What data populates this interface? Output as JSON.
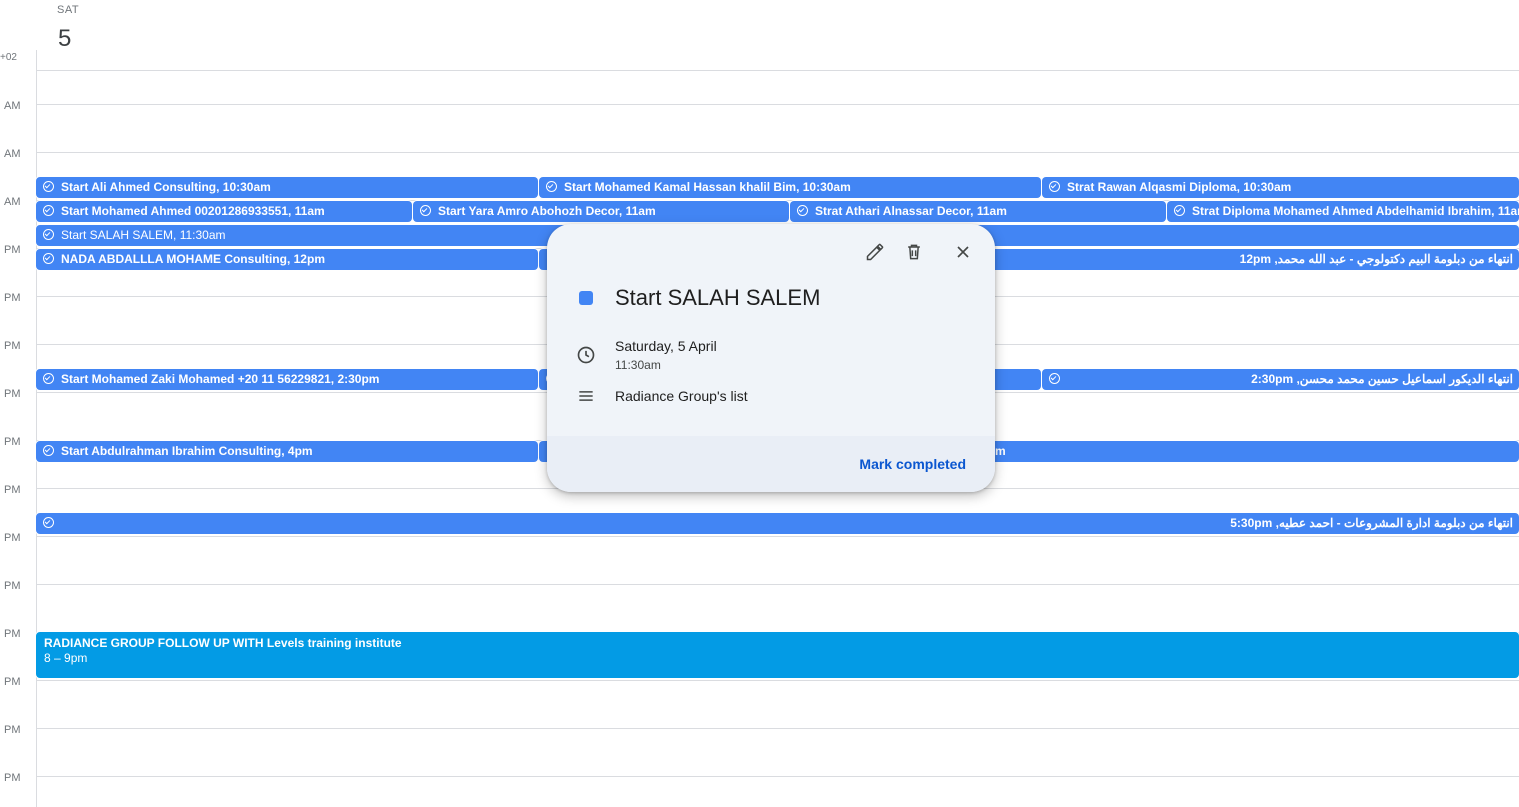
{
  "header": {
    "day_name": "SAT",
    "day_number": "5",
    "timezone": "+02"
  },
  "hour_labels": [
    "AM",
    "AM",
    "AM",
    "PM",
    "PM",
    "PM",
    "PM",
    "PM",
    "PM",
    "PM",
    "PM",
    "PM",
    "PM",
    "PM",
    "PM"
  ],
  "events": {
    "e1": "Start Ali Ahmed Consulting, 10:30am",
    "e2": "Start Mohamed Kamal Hassan khalil Bim, 10:30am",
    "e3": "Strat Rawan Alqasmi Diploma, 10:30am",
    "e4": "Start Mohamed Ahmed 00201286933551, 11am",
    "e5": "Start Yara Amro Abohozh Decor, 11am",
    "e6": "Strat Athari Alnassar Decor, 11am",
    "e7": "Strat Diploma Mohamed Ahmed Abdelhamid Ibrahim, 11am",
    "e8": "Start SALAH SALEM, 11:30am",
    "e9": "NADA ABDALLLA MOHAME Consulting, 12pm",
    "e10": "انتهاء من دبلومة البيم دكتولوجي - عبد الله محمد, 12pm",
    "e11": "Start Mohamed Zaki Mohamed +20 11 56229821, 2:30pm",
    "e12": "انتهاء الديكور اسماعيل حسين محمد محسن, 2:30pm",
    "e13": "Start Abdulrahman Ibrahim Consulting, 4pm",
    "e14_suffix": "m",
    "e15": "انتهاء من دبلومة ادارة المشروعات - احمد عطيه, 5:30pm"
  },
  "block_event": {
    "title": "RADIANCE GROUP FOLLOW UP WITH Levels training institute",
    "time": "8 – 9pm"
  },
  "popup": {
    "title": "Start SALAH SALEM",
    "date": "Saturday, 5 April",
    "time": "11:30am",
    "list": "Radiance Group's list",
    "mark_completed": "Mark completed",
    "color": "#4285f4"
  },
  "icons": [
    "edit-icon",
    "delete-icon",
    "close-icon",
    "clock-icon",
    "list-icon",
    "task-check-icon"
  ]
}
